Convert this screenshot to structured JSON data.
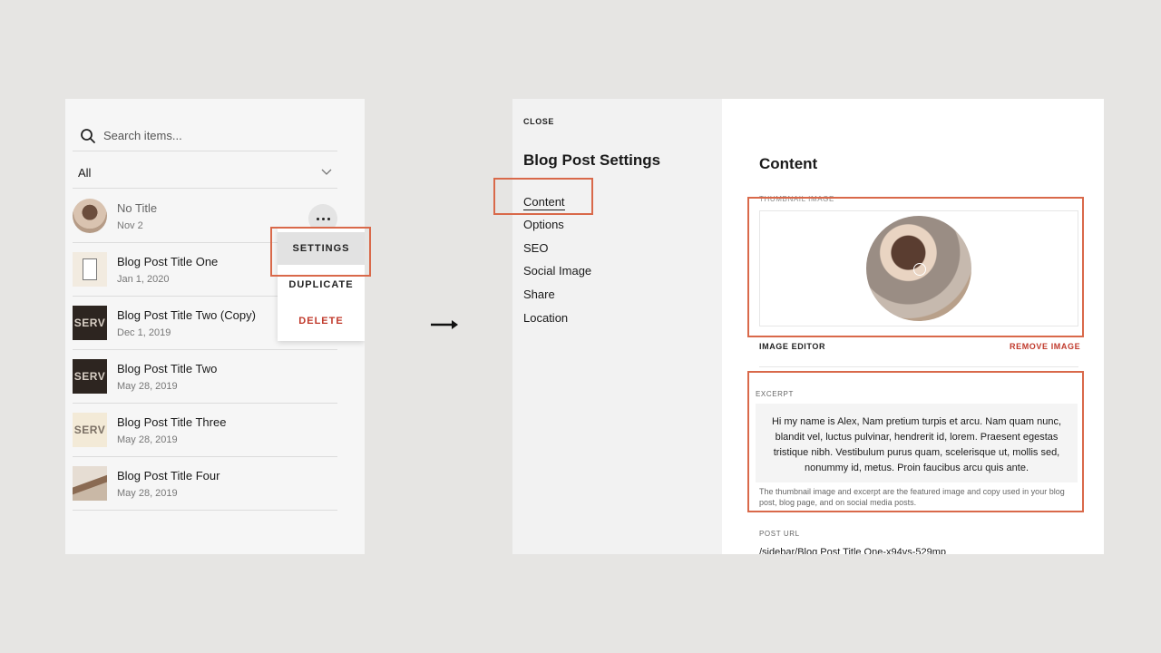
{
  "left_panel": {
    "search_placeholder": "Search items...",
    "filter_label": "All",
    "items": [
      {
        "title": "No Title",
        "date": "Nov 2"
      },
      {
        "title": "Blog Post Title One",
        "date": "Jan 1, 2020"
      },
      {
        "title": "Blog Post Title Two (Copy)",
        "date": "Dec 1, 2019",
        "thumb_text": "SERV"
      },
      {
        "title": "Blog Post Title Two",
        "date": "May 28, 2019",
        "thumb_text": "SERV"
      },
      {
        "title": "Blog Post Title Three",
        "date": "May 28, 2019",
        "thumb_text": "SERV"
      },
      {
        "title": "Blog Post Title Four",
        "date": "May 28, 2019"
      }
    ],
    "menu": {
      "settings": "SETTINGS",
      "duplicate": "DUPLICATE",
      "delete": "DELETE"
    }
  },
  "settings_panel": {
    "close_label": "CLOSE",
    "title": "Blog Post Settings",
    "nav": [
      "Content",
      "Options",
      "SEO",
      "Social Image",
      "Share",
      "Location"
    ],
    "active_nav": "Content"
  },
  "content": {
    "title": "Content",
    "thumbnail_label": "THUMBNAIL IMAGE",
    "image_editor": "IMAGE EDITOR",
    "remove_image": "REMOVE IMAGE",
    "excerpt_label": "EXCERPT",
    "excerpt": "Hi my name is Alex, Nam pretium turpis et arcu. Nam quam nunc, blandit vel, luctus pulvinar, hendrerit id, lorem. Praesent egestas tristique nibh. Vestibulum purus quam, scelerisque ut, mollis sed, nonummy id, metus. Proin faucibus arcu quis ante.",
    "excerpt_note": "The thumbnail image and excerpt are the featured image and copy used in your blog post, blog page, and on social media posts.",
    "post_url_label": "POST URL",
    "post_url": "/sidebar/Blog Post Title One-x94vs-529mp"
  },
  "colors": {
    "highlight": "#d9694a",
    "danger": "#c0392b"
  }
}
